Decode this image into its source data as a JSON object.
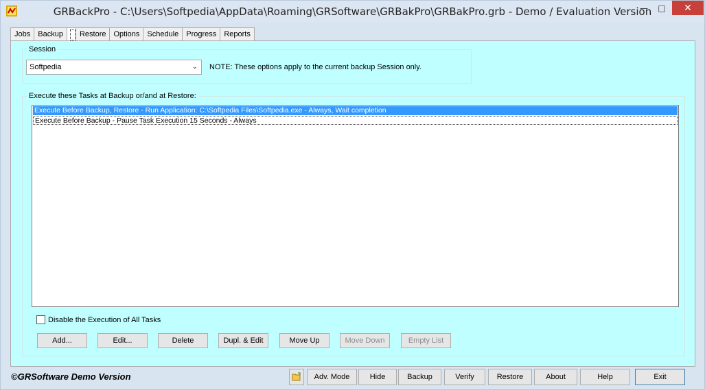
{
  "window": {
    "title": "GRBackPro - C:\\Users\\Softpedia\\AppData\\Roaming\\GRSoftware\\GRBakPro\\GRBakPro.grb - Demo / Evaluation Version",
    "min_glyph": "—",
    "max_glyph": "□",
    "close_glyph": "✕"
  },
  "tabs": [
    {
      "label": "Jobs"
    },
    {
      "label": "Backup"
    },
    {
      "label": ""
    },
    {
      "label": "Restore"
    },
    {
      "label": "Options"
    },
    {
      "label": "Schedule"
    },
    {
      "label": "Progress"
    },
    {
      "label": "Reports"
    }
  ],
  "session": {
    "group_label": "Session",
    "selected": "Softpedia",
    "dropdown_glyph": "⌄",
    "note": "NOTE: These options apply to the current backup Session only."
  },
  "tasks": {
    "group_label": "Execute these Tasks at Backup or/and at Restore:",
    "items": [
      "Execute Before Backup, Restore - Run Application: C:\\Softpedia Files\\Softpedia.exe   - Always, Wait completion",
      "Execute Before Backup - Pause Task Execution 15 Seconds  - Always"
    ],
    "disable_label": "Disable the Execution of All Tasks",
    "buttons": {
      "add": "Add...",
      "edit": "Edit...",
      "delete": "Delete",
      "dupl_edit": "Dupl. & Edit",
      "move_up": "Move Up",
      "move_down": "Move Down",
      "empty_list": "Empty List"
    }
  },
  "footer": {
    "brand": "©GRSoftware Demo Version",
    "buttons": {
      "adv_mode": "Adv. Mode",
      "hide": "Hide",
      "backup": "Backup",
      "verify": "Verify",
      "restore": "Restore",
      "about": "About",
      "help": "Help",
      "exit": "Exit"
    }
  },
  "colors": {
    "panel_bg": "#bfffff",
    "selection": "#3399ff",
    "close_button": "#c7403a"
  }
}
